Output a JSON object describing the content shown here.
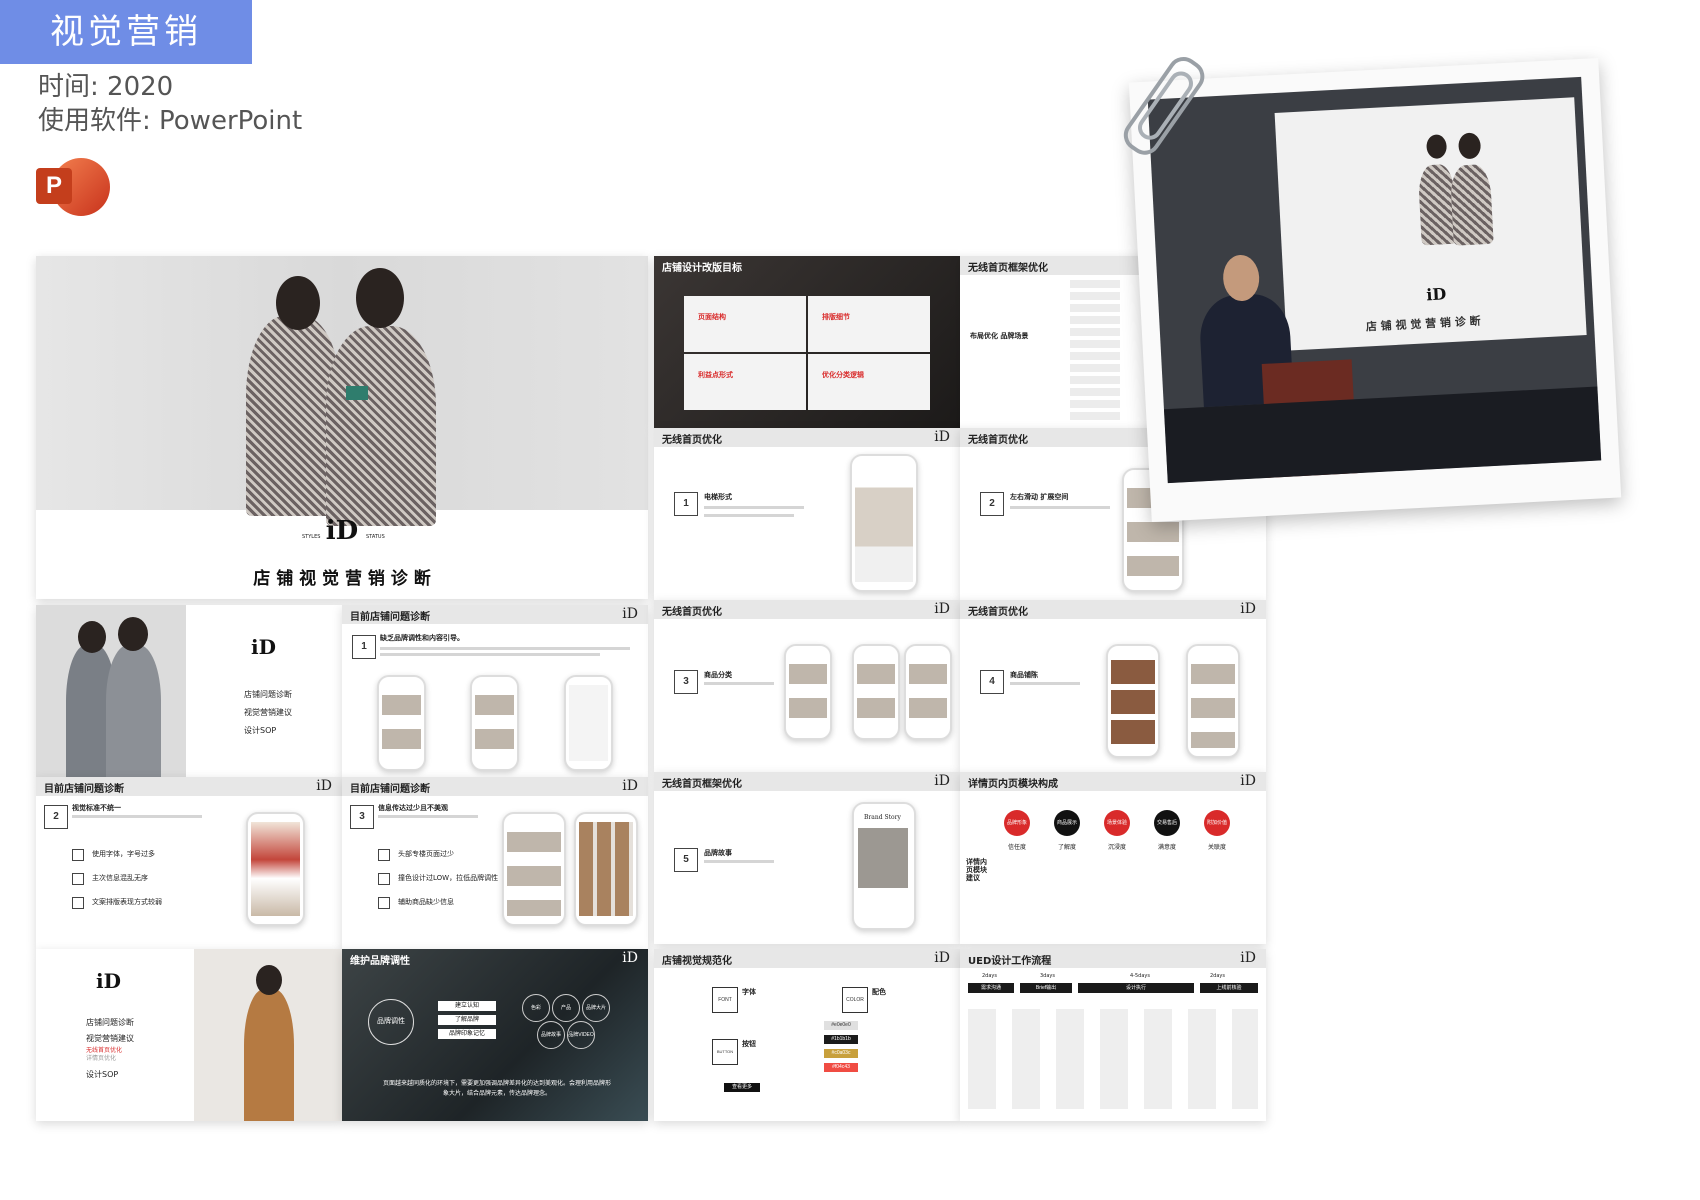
{
  "header": {
    "tag": "视觉营销",
    "time_label": "时间: 2020",
    "software_label": "使用软件: PowerPoint",
    "ppt_icon_letter": "P"
  },
  "brand": {
    "logo_mark": "iD",
    "logo_left": "STYLES",
    "logo_right": "STATUS"
  },
  "cover": {
    "title": "店 铺 视 觉 营 销 诊 断"
  },
  "agenda": {
    "items": [
      "店铺问题诊断",
      "视觉营销建议",
      "设计SOP"
    ]
  },
  "agenda2": {
    "items": [
      "店铺问题诊断",
      "视觉营销建议",
      "设计SOP"
    ],
    "red_item": "无线首页优化",
    "grey_item": "详情页优化"
  },
  "slides": {
    "diag1": {
      "title": "目前店铺问题诊断",
      "num": "1",
      "heading": "缺乏品牌调性和内容引导。"
    },
    "diag2": {
      "title": "目前店铺问题诊断",
      "num": "2",
      "heading": "视觉标准不统一",
      "bullets": [
        "使用字体，字号过多",
        "主次信息混乱无序",
        "文案排版表现方式较弱"
      ]
    },
    "diag3": {
      "title": "目前店铺问题诊断",
      "num": "3",
      "heading": "信息传达过少且不美观",
      "bullets": [
        "头部专楼页面过少",
        "撞色设计过LOW，拉低品牌调性",
        "辅助商品缺少信息"
      ]
    },
    "goals": {
      "title": "店铺设计改版目标",
      "cells": [
        "页面结构",
        "排版细节",
        "利益点形式",
        "优化分类逻辑"
      ]
    },
    "framework": {
      "title": "无线首页框架优化",
      "label": "布局优化 品牌场景"
    },
    "m1": {
      "title": "无线首页优化",
      "num": "1",
      "heading": "电梯形式"
    },
    "m2": {
      "title": "无线首页优化",
      "num": "2",
      "heading": "左右滑动 扩展空间"
    },
    "m3": {
      "title": "无线首页优化",
      "num": "3",
      "heading": "商品分类"
    },
    "m4": {
      "title": "无线首页优化",
      "num": "4",
      "heading": "商品铺陈"
    },
    "m5": {
      "title": "无线首页框架优化",
      "num": "5",
      "heading": "品牌故事",
      "phone_title": "Brand Story"
    },
    "detail": {
      "title": "详情页内页模块构成",
      "nodes": [
        {
          "badge": "品牌形象",
          "label": "信任度",
          "color": "#d92a2a"
        },
        {
          "badge": "商品展示",
          "label": "了解度",
          "color": "#111111"
        },
        {
          "badge": "场景体验",
          "label": "沉浸度",
          "color": "#d92a2a"
        },
        {
          "badge": "交易售后",
          "label": "满意度",
          "color": "#111111"
        },
        {
          "badge": "附加价值",
          "label": "关联度",
          "color": "#d92a2a"
        }
      ],
      "side_label": "详情内页模块建议"
    },
    "maintain": {
      "title": "维护品牌调性",
      "left_label": "品牌调性",
      "boxes": [
        "建立认知",
        "了解品牌",
        "品牌印象记忆"
      ],
      "circles": [
        "色彩",
        "产品",
        "品牌大片",
        "品牌故事",
        "品牌VIDEO"
      ],
      "caption": "页面越来越同质化的环境下，需要更加强调品牌差异化的达到美观化。会理利用品牌形象大片，结合品牌元素，传达品牌理念。"
    },
    "spec": {
      "title": "店铺视觉规范化",
      "font_box": "FONT",
      "font_label": "字体",
      "color_box": "COLOR",
      "color_label": "配色",
      "button_box": "BUTTON",
      "button_label": "按钮",
      "button_sample": "查看更多",
      "swatches": [
        {
          "hex": "#e0e0e0",
          "label": "#e0e0e0"
        },
        {
          "hex": "#1b1b1b",
          "label": "#1b1b1b"
        },
        {
          "hex": "#c8a03c",
          "label": "#c0a03c"
        },
        {
          "hex": "#f04c43",
          "label": "#f04c43"
        }
      ]
    },
    "ued": {
      "title": "UED设计工作流程",
      "days": [
        "2days",
        "3days",
        "4-5days",
        "2days"
      ],
      "stages": [
        "需求沟通",
        "Brief输出",
        "设计执行",
        "上线前核验"
      ]
    }
  },
  "colors": {
    "tag": "#6f8de6",
    "red": "#d92a2a",
    "bar": "#e7e7e7"
  }
}
